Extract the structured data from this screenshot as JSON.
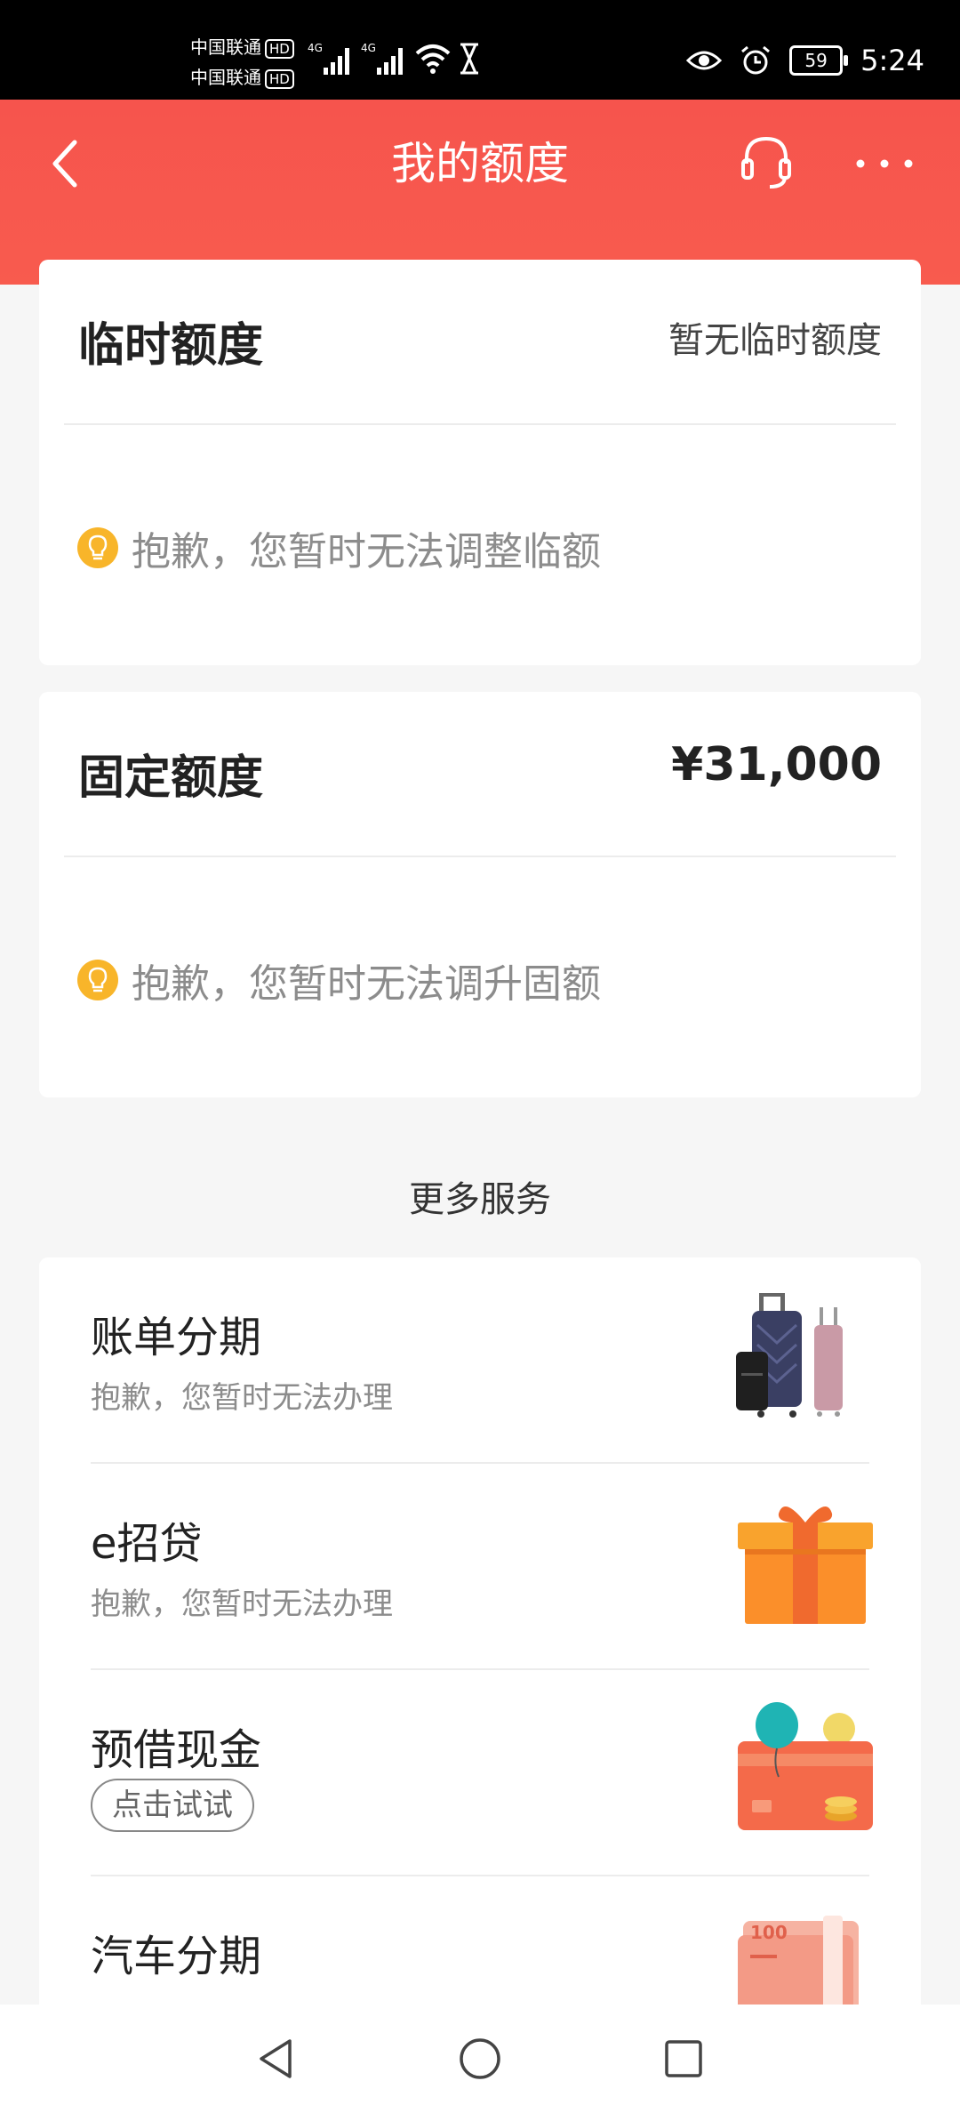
{
  "status_bar": {
    "carrier1": "中国联通",
    "carrier2": "中国联通",
    "hd": "HD",
    "net1": "4G",
    "net2": "4G",
    "battery": "59",
    "time": "5:24"
  },
  "header": {
    "title": "我的额度"
  },
  "temp_limit": {
    "title": "临时额度",
    "value": "暂无临时额度",
    "notice": "抱歉，您暂时无法调整临额"
  },
  "fixed_limit": {
    "title": "固定额度",
    "value": "¥31,000",
    "notice": "抱歉，您暂时无法调升固额"
  },
  "more_services": {
    "title": "更多服务",
    "items": [
      {
        "name": "账单分期",
        "subtitle": "抱歉，您暂时无法办理"
      },
      {
        "name": "e招贷",
        "subtitle": "抱歉，您暂时无法办理"
      },
      {
        "name": "预借现金",
        "tag": "点击试试"
      },
      {
        "name": "汽车分期",
        "pic_label": "100"
      }
    ]
  },
  "colors": {
    "brand_red": "#f6544d",
    "bulb_yellow": "#f8b52a"
  }
}
